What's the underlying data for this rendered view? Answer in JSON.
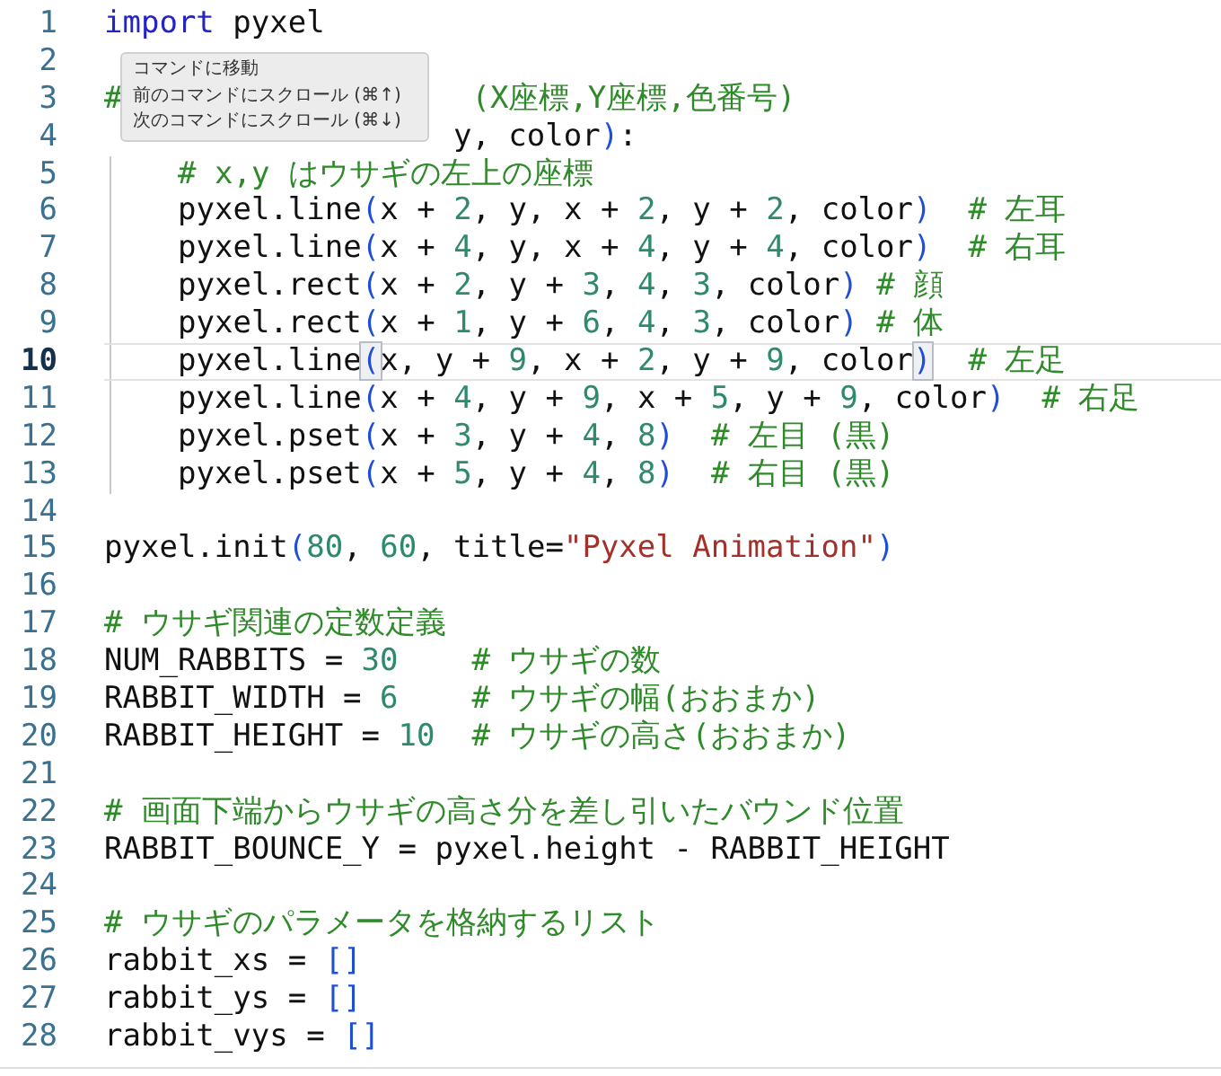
{
  "tooltip": {
    "items": [
      "コマンドに移動",
      "前のコマンドにスクロール (⌘↑)",
      "次のコマンドにスクロール (⌘↓)"
    ]
  },
  "lines": [
    {
      "n": "1",
      "current": false,
      "indented": false,
      "tokens": [
        {
          "kind": "kw",
          "text": "import"
        },
        {
          "kind": "plain",
          "text": " pyxel"
        }
      ]
    },
    {
      "n": "2",
      "current": false,
      "indented": false
    },
    {
      "n": "3",
      "current": false,
      "indented": false,
      "tokens": [
        {
          "kind": "comment",
          "text": "#"
        },
        {
          "kind": "gap"
        },
        {
          "kind": "comment",
          "text": "(X座標,Y座標,色番号)"
        }
      ]
    },
    {
      "n": "4",
      "current": false,
      "indented": false,
      "tokens": [
        {
          "kind": "gap"
        },
        {
          "kind": "plain",
          "text": "y, color"
        },
        {
          "kind": "paren",
          "text": ")"
        },
        {
          "kind": "plain",
          "text": ":"
        }
      ]
    },
    {
      "n": "5",
      "current": false,
      "indented": true,
      "tokens": [
        {
          "kind": "comment",
          "text": "# x,y はウサギの左上の座標"
        }
      ]
    },
    {
      "n": "6",
      "current": false,
      "indented": true,
      "tokens": [
        {
          "kind": "plain",
          "text": "pyxel.line"
        },
        {
          "kind": "paren",
          "text": "("
        },
        {
          "kind": "plain",
          "text": "x + "
        },
        {
          "kind": "num",
          "text": "2"
        },
        {
          "kind": "plain",
          "text": ", y, x + "
        },
        {
          "kind": "num",
          "text": "2"
        },
        {
          "kind": "plain",
          "text": ", y + "
        },
        {
          "kind": "num",
          "text": "2"
        },
        {
          "kind": "plain",
          "text": ", color"
        },
        {
          "kind": "paren",
          "text": ")"
        },
        {
          "kind": "comment",
          "text": "  # 左耳"
        }
      ]
    },
    {
      "n": "7",
      "current": false,
      "indented": true,
      "tokens": [
        {
          "kind": "plain",
          "text": "pyxel.line"
        },
        {
          "kind": "paren",
          "text": "("
        },
        {
          "kind": "plain",
          "text": "x + "
        },
        {
          "kind": "num",
          "text": "4"
        },
        {
          "kind": "plain",
          "text": ", y, x + "
        },
        {
          "kind": "num",
          "text": "4"
        },
        {
          "kind": "plain",
          "text": ", y + "
        },
        {
          "kind": "num",
          "text": "4"
        },
        {
          "kind": "plain",
          "text": ", color"
        },
        {
          "kind": "paren",
          "text": ")"
        },
        {
          "kind": "comment",
          "text": "  # 右耳"
        }
      ]
    },
    {
      "n": "8",
      "current": false,
      "indented": true,
      "tokens": [
        {
          "kind": "plain",
          "text": "pyxel.rect"
        },
        {
          "kind": "paren",
          "text": "("
        },
        {
          "kind": "plain",
          "text": "x + "
        },
        {
          "kind": "num",
          "text": "2"
        },
        {
          "kind": "plain",
          "text": ", y + "
        },
        {
          "kind": "num",
          "text": "3"
        },
        {
          "kind": "plain",
          "text": ", "
        },
        {
          "kind": "num",
          "text": "4"
        },
        {
          "kind": "plain",
          "text": ", "
        },
        {
          "kind": "num",
          "text": "3"
        },
        {
          "kind": "plain",
          "text": ", color"
        },
        {
          "kind": "paren",
          "text": ")"
        },
        {
          "kind": "comment",
          "text": " # 顔"
        }
      ]
    },
    {
      "n": "9",
      "current": false,
      "indented": true,
      "tokens": [
        {
          "kind": "plain",
          "text": "pyxel.rect"
        },
        {
          "kind": "paren",
          "text": "("
        },
        {
          "kind": "plain",
          "text": "x + "
        },
        {
          "kind": "num",
          "text": "1"
        },
        {
          "kind": "plain",
          "text": ", y + "
        },
        {
          "kind": "num",
          "text": "6"
        },
        {
          "kind": "plain",
          "text": ", "
        },
        {
          "kind": "num",
          "text": "4"
        },
        {
          "kind": "plain",
          "text": ", "
        },
        {
          "kind": "num",
          "text": "3"
        },
        {
          "kind": "plain",
          "text": ", color"
        },
        {
          "kind": "paren",
          "text": ")"
        },
        {
          "kind": "comment",
          "text": " # 体"
        }
      ]
    },
    {
      "n": "10",
      "current": true,
      "indented": true,
      "tokens": [
        {
          "kind": "plain",
          "text": "pyxel.line"
        },
        {
          "kind": "paren",
          "text": "(",
          "match": true
        },
        {
          "kind": "plain",
          "text": "x, y + "
        },
        {
          "kind": "num",
          "text": "9"
        },
        {
          "kind": "plain",
          "text": ", x + "
        },
        {
          "kind": "num",
          "text": "2"
        },
        {
          "kind": "plain",
          "text": ", y + "
        },
        {
          "kind": "num",
          "text": "9"
        },
        {
          "kind": "plain",
          "text": ", color"
        },
        {
          "kind": "paren",
          "text": ")",
          "match": true
        },
        {
          "kind": "comment",
          "text": "  # 左足"
        }
      ]
    },
    {
      "n": "11",
      "current": false,
      "indented": true,
      "tokens": [
        {
          "kind": "plain",
          "text": "pyxel.line"
        },
        {
          "kind": "paren",
          "text": "("
        },
        {
          "kind": "plain",
          "text": "x + "
        },
        {
          "kind": "num",
          "text": "4"
        },
        {
          "kind": "plain",
          "text": ", y + "
        },
        {
          "kind": "num",
          "text": "9"
        },
        {
          "kind": "plain",
          "text": ", x + "
        },
        {
          "kind": "num",
          "text": "5"
        },
        {
          "kind": "plain",
          "text": ", y + "
        },
        {
          "kind": "num",
          "text": "9"
        },
        {
          "kind": "plain",
          "text": ", color"
        },
        {
          "kind": "paren",
          "text": ")"
        },
        {
          "kind": "comment",
          "text": "  # 右足"
        }
      ]
    },
    {
      "n": "12",
      "current": false,
      "indented": true,
      "tokens": [
        {
          "kind": "plain",
          "text": "pyxel.pset"
        },
        {
          "kind": "paren",
          "text": "("
        },
        {
          "kind": "plain",
          "text": "x + "
        },
        {
          "kind": "num",
          "text": "3"
        },
        {
          "kind": "plain",
          "text": ", y + "
        },
        {
          "kind": "num",
          "text": "4"
        },
        {
          "kind": "plain",
          "text": ", "
        },
        {
          "kind": "num",
          "text": "8"
        },
        {
          "kind": "paren",
          "text": ")"
        },
        {
          "kind": "comment",
          "text": "  # 左目 (黒)"
        }
      ]
    },
    {
      "n": "13",
      "current": false,
      "indented": true,
      "tokens": [
        {
          "kind": "plain",
          "text": "pyxel.pset"
        },
        {
          "kind": "paren",
          "text": "("
        },
        {
          "kind": "plain",
          "text": "x + "
        },
        {
          "kind": "num",
          "text": "5"
        },
        {
          "kind": "plain",
          "text": ", y + "
        },
        {
          "kind": "num",
          "text": "4"
        },
        {
          "kind": "plain",
          "text": ", "
        },
        {
          "kind": "num",
          "text": "8"
        },
        {
          "kind": "paren",
          "text": ")"
        },
        {
          "kind": "comment",
          "text": "  # 右目 (黒)"
        }
      ]
    },
    {
      "n": "14",
      "current": false,
      "indented": false
    },
    {
      "n": "15",
      "current": false,
      "indented": false,
      "tokens": [
        {
          "kind": "plain",
          "text": "pyxel.init"
        },
        {
          "kind": "paren",
          "text": "("
        },
        {
          "kind": "num",
          "text": "80"
        },
        {
          "kind": "plain",
          "text": ", "
        },
        {
          "kind": "num",
          "text": "60"
        },
        {
          "kind": "plain",
          "text": ", title="
        },
        {
          "kind": "str",
          "text": "\"Pyxel Animation\""
        },
        {
          "kind": "paren",
          "text": ")"
        }
      ]
    },
    {
      "n": "16",
      "current": false,
      "indented": false
    },
    {
      "n": "17",
      "current": false,
      "indented": false,
      "tokens": [
        {
          "kind": "comment",
          "text": "# ウサギ関連の定数定義"
        }
      ]
    },
    {
      "n": "18",
      "current": false,
      "indented": false,
      "tokens": [
        {
          "kind": "plain",
          "text": "NUM_RABBITS = "
        },
        {
          "kind": "num",
          "text": "30"
        },
        {
          "kind": "comment",
          "text": "    # ウサギの数"
        }
      ]
    },
    {
      "n": "19",
      "current": false,
      "indented": false,
      "tokens": [
        {
          "kind": "plain",
          "text": "RABBIT_WIDTH = "
        },
        {
          "kind": "num",
          "text": "6"
        },
        {
          "kind": "comment",
          "text": "    # ウサギの幅(おおまか)"
        }
      ]
    },
    {
      "n": "20",
      "current": false,
      "indented": false,
      "tokens": [
        {
          "kind": "plain",
          "text": "RABBIT_HEIGHT = "
        },
        {
          "kind": "num",
          "text": "10"
        },
        {
          "kind": "comment",
          "text": "  # ウサギの高さ(おおまか)"
        }
      ]
    },
    {
      "n": "21",
      "current": false,
      "indented": false
    },
    {
      "n": "22",
      "current": false,
      "indented": false,
      "tokens": [
        {
          "kind": "comment",
          "text": "# 画面下端からウサギの高さ分を差し引いたバウンド位置"
        }
      ]
    },
    {
      "n": "23",
      "current": false,
      "indented": false,
      "tokens": [
        {
          "kind": "plain",
          "text": "RABBIT_BOUNCE_Y = pyxel.height - RABBIT_HEIGHT"
        }
      ]
    },
    {
      "n": "24",
      "current": false,
      "indented": false
    },
    {
      "n": "25",
      "current": false,
      "indented": false,
      "tokens": [
        {
          "kind": "comment",
          "text": "# ウサギのパラメータを格納するリスト"
        }
      ]
    },
    {
      "n": "26",
      "current": false,
      "indented": false,
      "tokens": [
        {
          "kind": "plain",
          "text": "rabbit_xs = "
        },
        {
          "kind": "paren",
          "text": "[]"
        }
      ]
    },
    {
      "n": "27",
      "current": false,
      "indented": false,
      "tokens": [
        {
          "kind": "plain",
          "text": "rabbit_ys = "
        },
        {
          "kind": "paren",
          "text": "[]"
        }
      ]
    },
    {
      "n": "28",
      "current": false,
      "indented": false,
      "tokens": [
        {
          "kind": "plain",
          "text": "rabbit_vys = "
        },
        {
          "kind": "paren",
          "text": "[]"
        }
      ]
    }
  ]
}
